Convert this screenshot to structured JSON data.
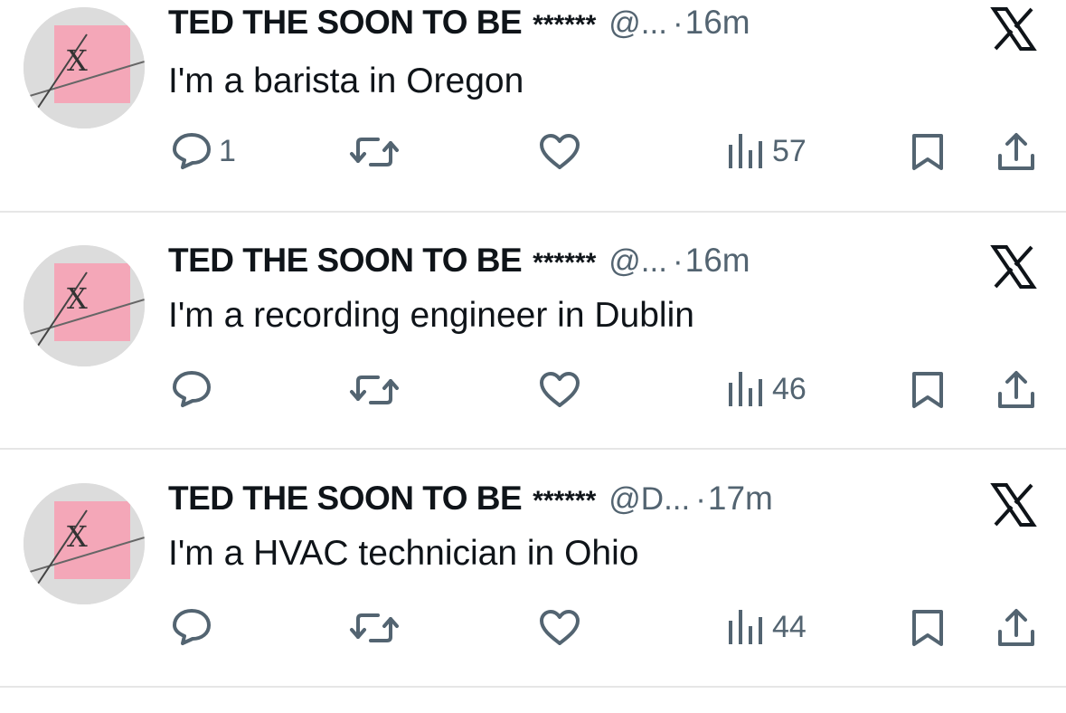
{
  "tweets": [
    {
      "name": "TED THE SOON TO BE",
      "stars": "******",
      "handle": "@...",
      "dot": "·",
      "time": "16m",
      "text": "I'm a barista in Oregon",
      "replies": "1",
      "views": "57"
    },
    {
      "name": "TED THE SOON TO BE",
      "stars": "******",
      "handle": "@...",
      "dot": "·",
      "time": "16m",
      "text": "I'm a recording engineer in Dublin",
      "replies": "",
      "views": "46"
    },
    {
      "name": "TED THE SOON TO BE",
      "stars": "******",
      "handle": "@D...",
      "dot": "·",
      "time": "17m",
      "text": "I'm a HVAC technician in Ohio",
      "replies": "",
      "views": "44"
    }
  ],
  "icons": {
    "brand": "x-logo-icon",
    "reply": "reply-bubble-icon",
    "retweet": "retweet-icon",
    "like": "heart-icon",
    "views": "views-bars-icon",
    "bookmark": "bookmark-icon",
    "share": "share-icon"
  },
  "colors": {
    "text_primary": "#0f1419",
    "text_secondary": "#536471",
    "divider": "#e6e6e6",
    "avatar_pink": "#f4a7b8"
  }
}
